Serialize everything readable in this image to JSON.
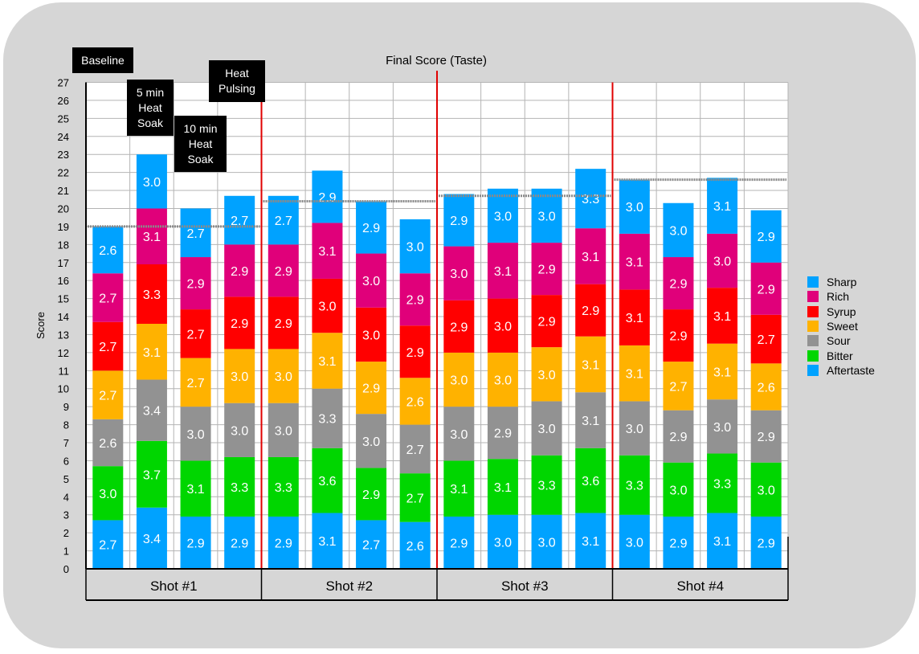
{
  "chart_data": {
    "type": "bar",
    "stacked": true,
    "title": "Final Score (Taste)",
    "xlabel": "",
    "ylabel": "Score",
    "ylim": [
      0,
      27
    ],
    "yticks": [
      0,
      1,
      2,
      3,
      4,
      5,
      6,
      7,
      8,
      9,
      10,
      11,
      12,
      13,
      14,
      15,
      16,
      17,
      18,
      19,
      20,
      21,
      22,
      23,
      24,
      25,
      26,
      27
    ],
    "grid": true,
    "legend_position": "right",
    "groups": [
      "Shot #1",
      "Shot #2",
      "Shot #3",
      "Shot #4"
    ],
    "conditions": [
      "Baseline",
      "5 min Heat Soak",
      "10 min Heat Soak",
      "Heat Pulsing"
    ],
    "categories": [
      "Shot #1 Baseline",
      "Shot #1 5 min Heat Soak",
      "Shot #1 10 min Heat Soak",
      "Shot #1 Heat Pulsing",
      "Shot #2 Baseline",
      "Shot #2 5 min Heat Soak",
      "Shot #2 10 min Heat Soak",
      "Shot #2 Heat Pulsing",
      "Shot #3 Baseline",
      "Shot #3 5 min Heat Soak",
      "Shot #3 10 min Heat Soak",
      "Shot #3 Heat Pulsing",
      "Shot #4 Baseline",
      "Shot #4 5 min Heat Soak",
      "Shot #4 10 min Heat Soak",
      "Shot #4 Heat Pulsing"
    ],
    "series": [
      {
        "name": "Aftertaste",
        "color": "#00a2ff",
        "values": [
          2.7,
          3.4,
          2.9,
          2.9,
          2.9,
          3.1,
          2.7,
          2.6,
          2.9,
          3.0,
          3.0,
          3.1,
          3.0,
          2.9,
          3.1,
          2.9
        ]
      },
      {
        "name": "Bitter",
        "color": "#00d600",
        "values": [
          3.0,
          3.7,
          3.1,
          3.3,
          3.3,
          3.6,
          2.9,
          2.7,
          3.1,
          3.1,
          3.3,
          3.6,
          3.3,
          3.0,
          3.3,
          3.0
        ]
      },
      {
        "name": "Sour",
        "color": "#929292",
        "values": [
          2.6,
          3.4,
          3.0,
          3.0,
          3.0,
          3.3,
          3.0,
          2.7,
          3.0,
          2.9,
          3.0,
          3.1,
          3.0,
          2.9,
          3.0,
          2.9
        ]
      },
      {
        "name": "Sweet",
        "color": "#ffb200",
        "values": [
          2.7,
          3.1,
          2.7,
          3.0,
          3.0,
          3.1,
          2.9,
          2.6,
          3.0,
          3.0,
          3.0,
          3.1,
          3.1,
          2.7,
          3.1,
          2.6
        ]
      },
      {
        "name": "Syrup",
        "color": "#ff0000",
        "values": [
          2.7,
          3.3,
          2.7,
          2.9,
          2.9,
          3.0,
          3.0,
          2.9,
          2.9,
          3.0,
          2.9,
          2.9,
          3.1,
          2.9,
          3.1,
          2.7
        ]
      },
      {
        "name": "Rich",
        "color": "#e0007a",
        "values": [
          2.7,
          3.1,
          2.9,
          2.9,
          2.9,
          3.1,
          3.0,
          2.9,
          3.0,
          3.1,
          2.9,
          3.1,
          3.1,
          2.9,
          3.0,
          2.9
        ]
      },
      {
        "name": "Sharp",
        "color": "#00a2ff",
        "values": [
          2.6,
          3.0,
          2.7,
          2.7,
          2.7,
          2.9,
          2.9,
          3.0,
          2.9,
          3.0,
          3.0,
          3.3,
          3.0,
          3.0,
          3.1,
          2.9
        ]
      }
    ],
    "legend": [
      "Sharp",
      "Rich",
      "Syrup",
      "Sweet",
      "Sour",
      "Bitter",
      "Aftertaste"
    ],
    "baseline_reference_lines": [
      {
        "group": "Shot #1",
        "value": 19.0
      },
      {
        "group": "Shot #2",
        "value": 20.4
      },
      {
        "group": "Shot #3",
        "value": 20.7
      },
      {
        "group": "Shot #4",
        "value": 21.6
      }
    ],
    "group_dividers_color": "#e00000",
    "annotations": [
      {
        "text": "Baseline",
        "lines": [
          "Baseline"
        ]
      },
      {
        "text": "5 min Heat Soak",
        "lines": [
          "5 min",
          "Heat",
          "Soak"
        ]
      },
      {
        "text": "10 min Heat Soak",
        "lines": [
          "10 min",
          "Heat",
          "Soak"
        ]
      },
      {
        "text": "Heat Pulsing",
        "lines": [
          "Heat",
          "Pulsing"
        ]
      }
    ]
  }
}
